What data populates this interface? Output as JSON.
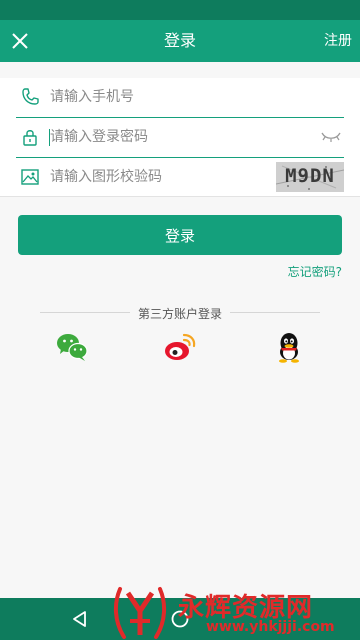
{
  "header": {
    "title": "登录",
    "register_label": "注册"
  },
  "form": {
    "phone_placeholder": "请输入手机号",
    "password_placeholder": "请输入登录密码",
    "captcha_placeholder": "请输入图形校验码",
    "captcha_text": "M9DN"
  },
  "login_button_label": "登录",
  "forgot_password_label": "忘记密码?",
  "third_party": {
    "label": "第三方账户登录",
    "providers": [
      "wechat-icon",
      "weibo-icon",
      "qq-icon"
    ]
  },
  "watermark": {
    "title": "永辉资源网",
    "url": "www.yhkjjji.com"
  },
  "colors": {
    "primary": "#14a07c",
    "status_bar": "#0e7c5d",
    "watermark": "#e02a2a"
  }
}
